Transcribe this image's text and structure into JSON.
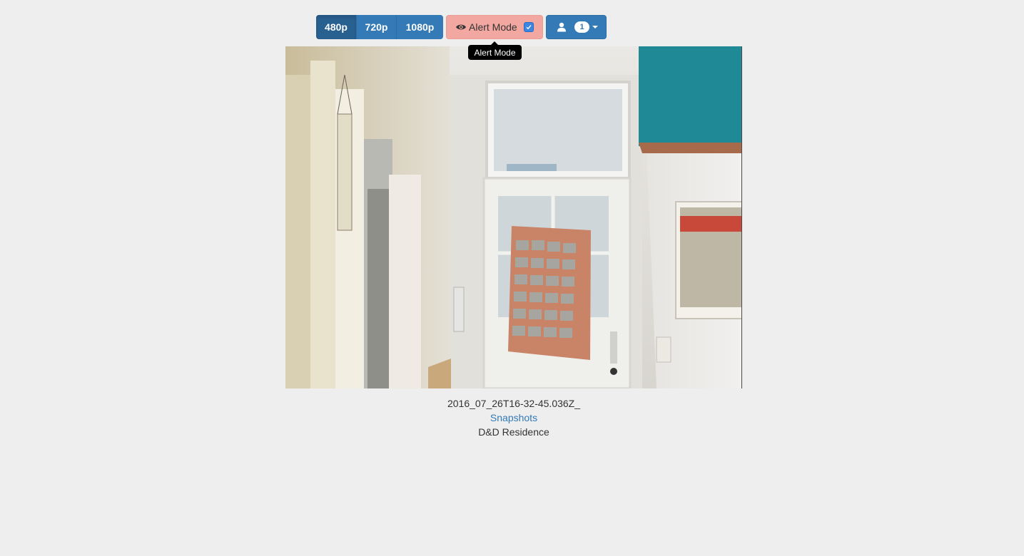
{
  "toolbar": {
    "resolutions": [
      {
        "label": "480p",
        "active": true
      },
      {
        "label": "720p",
        "active": false
      },
      {
        "label": "1080p",
        "active": false
      }
    ],
    "alert_mode": {
      "label": "Alert Mode",
      "icon": "eye-icon",
      "checked": true,
      "color": "#f2a8a0"
    },
    "user_menu": {
      "icon": "user-icon",
      "badge_count": "1"
    },
    "accent_color": "#337ab7"
  },
  "tooltip": {
    "text": "Alert Mode"
  },
  "camera": {
    "image_description_icon": "camera-snapshot-image"
  },
  "caption": {
    "timestamp": "2016_07_26T16-32-45.036Z_",
    "snapshots_link": "Snapshots",
    "location": "D&D Residence"
  }
}
